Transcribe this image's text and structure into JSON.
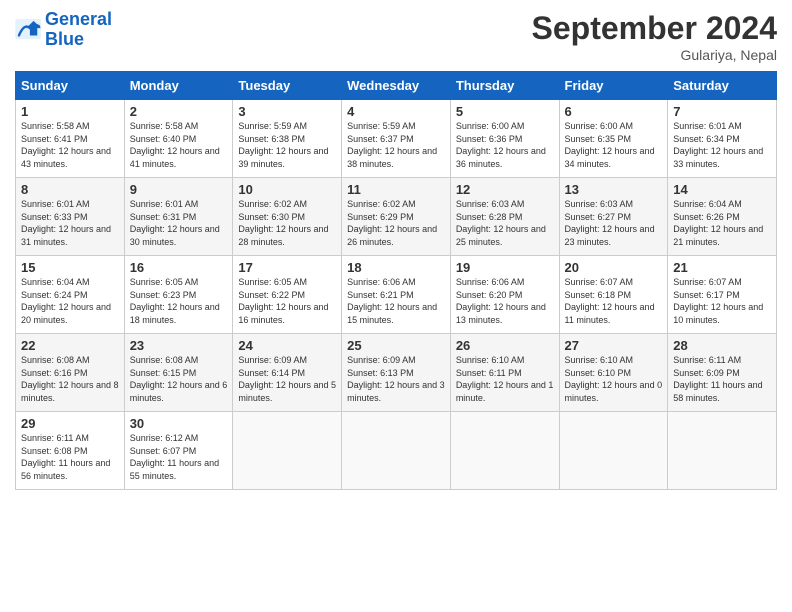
{
  "header": {
    "logo_line1": "General",
    "logo_line2": "Blue",
    "month_title": "September 2024",
    "location": "Gulariya, Nepal"
  },
  "days_of_week": [
    "Sunday",
    "Monday",
    "Tuesday",
    "Wednesday",
    "Thursday",
    "Friday",
    "Saturday"
  ],
  "weeks": [
    [
      {
        "day": "1",
        "sunrise": "5:58 AM",
        "sunset": "6:41 PM",
        "daylight": "12 hours and 43 minutes."
      },
      {
        "day": "2",
        "sunrise": "5:58 AM",
        "sunset": "6:40 PM",
        "daylight": "12 hours and 41 minutes."
      },
      {
        "day": "3",
        "sunrise": "5:59 AM",
        "sunset": "6:38 PM",
        "daylight": "12 hours and 39 minutes."
      },
      {
        "day": "4",
        "sunrise": "5:59 AM",
        "sunset": "6:37 PM",
        "daylight": "12 hours and 38 minutes."
      },
      {
        "day": "5",
        "sunrise": "6:00 AM",
        "sunset": "6:36 PM",
        "daylight": "12 hours and 36 minutes."
      },
      {
        "day": "6",
        "sunrise": "6:00 AM",
        "sunset": "6:35 PM",
        "daylight": "12 hours and 34 minutes."
      },
      {
        "day": "7",
        "sunrise": "6:01 AM",
        "sunset": "6:34 PM",
        "daylight": "12 hours and 33 minutes."
      }
    ],
    [
      {
        "day": "8",
        "sunrise": "6:01 AM",
        "sunset": "6:33 PM",
        "daylight": "12 hours and 31 minutes."
      },
      {
        "day": "9",
        "sunrise": "6:01 AM",
        "sunset": "6:31 PM",
        "daylight": "12 hours and 30 minutes."
      },
      {
        "day": "10",
        "sunrise": "6:02 AM",
        "sunset": "6:30 PM",
        "daylight": "12 hours and 28 minutes."
      },
      {
        "day": "11",
        "sunrise": "6:02 AM",
        "sunset": "6:29 PM",
        "daylight": "12 hours and 26 minutes."
      },
      {
        "day": "12",
        "sunrise": "6:03 AM",
        "sunset": "6:28 PM",
        "daylight": "12 hours and 25 minutes."
      },
      {
        "day": "13",
        "sunrise": "6:03 AM",
        "sunset": "6:27 PM",
        "daylight": "12 hours and 23 minutes."
      },
      {
        "day": "14",
        "sunrise": "6:04 AM",
        "sunset": "6:26 PM",
        "daylight": "12 hours and 21 minutes."
      }
    ],
    [
      {
        "day": "15",
        "sunrise": "6:04 AM",
        "sunset": "6:24 PM",
        "daylight": "12 hours and 20 minutes."
      },
      {
        "day": "16",
        "sunrise": "6:05 AM",
        "sunset": "6:23 PM",
        "daylight": "12 hours and 18 minutes."
      },
      {
        "day": "17",
        "sunrise": "6:05 AM",
        "sunset": "6:22 PM",
        "daylight": "12 hours and 16 minutes."
      },
      {
        "day": "18",
        "sunrise": "6:06 AM",
        "sunset": "6:21 PM",
        "daylight": "12 hours and 15 minutes."
      },
      {
        "day": "19",
        "sunrise": "6:06 AM",
        "sunset": "6:20 PM",
        "daylight": "12 hours and 13 minutes."
      },
      {
        "day": "20",
        "sunrise": "6:07 AM",
        "sunset": "6:18 PM",
        "daylight": "12 hours and 11 minutes."
      },
      {
        "day": "21",
        "sunrise": "6:07 AM",
        "sunset": "6:17 PM",
        "daylight": "12 hours and 10 minutes."
      }
    ],
    [
      {
        "day": "22",
        "sunrise": "6:08 AM",
        "sunset": "6:16 PM",
        "daylight": "12 hours and 8 minutes."
      },
      {
        "day": "23",
        "sunrise": "6:08 AM",
        "sunset": "6:15 PM",
        "daylight": "12 hours and 6 minutes."
      },
      {
        "day": "24",
        "sunrise": "6:09 AM",
        "sunset": "6:14 PM",
        "daylight": "12 hours and 5 minutes."
      },
      {
        "day": "25",
        "sunrise": "6:09 AM",
        "sunset": "6:13 PM",
        "daylight": "12 hours and 3 minutes."
      },
      {
        "day": "26",
        "sunrise": "6:10 AM",
        "sunset": "6:11 PM",
        "daylight": "12 hours and 1 minute."
      },
      {
        "day": "27",
        "sunrise": "6:10 AM",
        "sunset": "6:10 PM",
        "daylight": "12 hours and 0 minutes."
      },
      {
        "day": "28",
        "sunrise": "6:11 AM",
        "sunset": "6:09 PM",
        "daylight": "11 hours and 58 minutes."
      }
    ],
    [
      {
        "day": "29",
        "sunrise": "6:11 AM",
        "sunset": "6:08 PM",
        "daylight": "11 hours and 56 minutes."
      },
      {
        "day": "30",
        "sunrise": "6:12 AM",
        "sunset": "6:07 PM",
        "daylight": "11 hours and 55 minutes."
      },
      null,
      null,
      null,
      null,
      null
    ]
  ]
}
